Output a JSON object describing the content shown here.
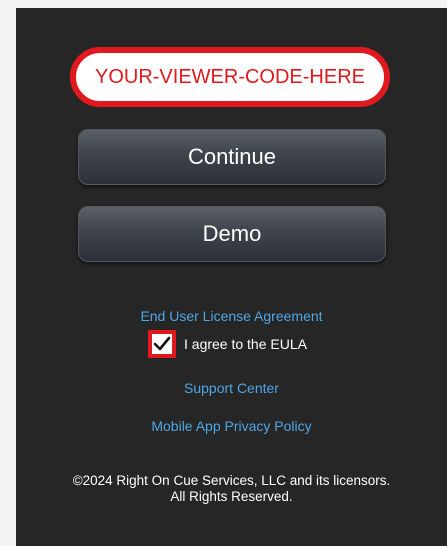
{
  "viewer_code": {
    "value": "",
    "placeholder": "YOUR-VIEWER-CODE-HERE"
  },
  "buttons": {
    "continue_label": "Continue",
    "demo_label": "Demo"
  },
  "links": {
    "eula": "End User License Agreement",
    "support": "Support Center",
    "privacy": "Mobile App Privacy Policy"
  },
  "agreement": {
    "label": "I agree to the EULA",
    "checked": true,
    "icon": "checkmark-icon"
  },
  "footer": {
    "line1": "©2024 Right On Cue Services, LLC and its licensors.",
    "line2": "All Rights Reserved."
  },
  "colors": {
    "background": "#262626",
    "accent_red": "#e1191f",
    "link_blue": "#4fa6e4"
  }
}
